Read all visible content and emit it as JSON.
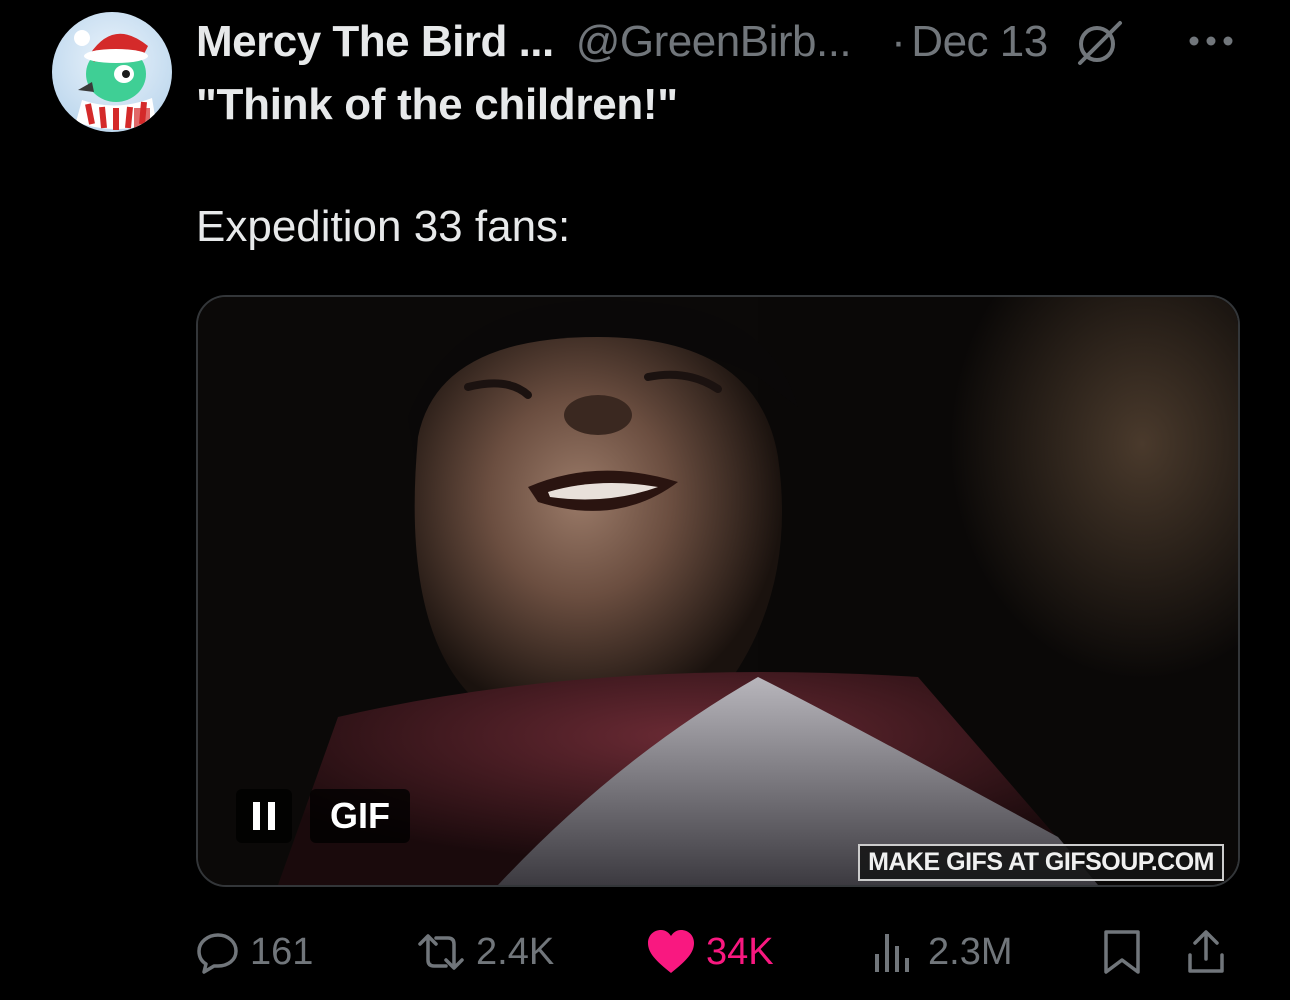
{
  "author": {
    "display_name": "Mercy The Bird ...",
    "handle": "@GreenBirb...",
    "date": "Dec 13",
    "separator": "·"
  },
  "tweet": {
    "line1": "\"Think of the children!\"",
    "line2": "Expedition 33 fans:"
  },
  "media": {
    "badge": "GIF",
    "watermark": "MAKE GIFS AT GIFSOUP.COM"
  },
  "metrics": {
    "replies": "161",
    "reposts": "2.4K",
    "likes": "34K",
    "views": "2.3M"
  },
  "colors": {
    "background": "#000000",
    "text_primary": "#e7e9ea",
    "text_secondary": "#71767b",
    "like_pink": "#f91880",
    "border": "#333639"
  },
  "icons": [
    "avatar",
    "grok-icon",
    "more-icon",
    "pause-icon",
    "reply-icon",
    "repost-icon",
    "like-icon",
    "views-icon",
    "bookmark-icon",
    "share-icon"
  ]
}
